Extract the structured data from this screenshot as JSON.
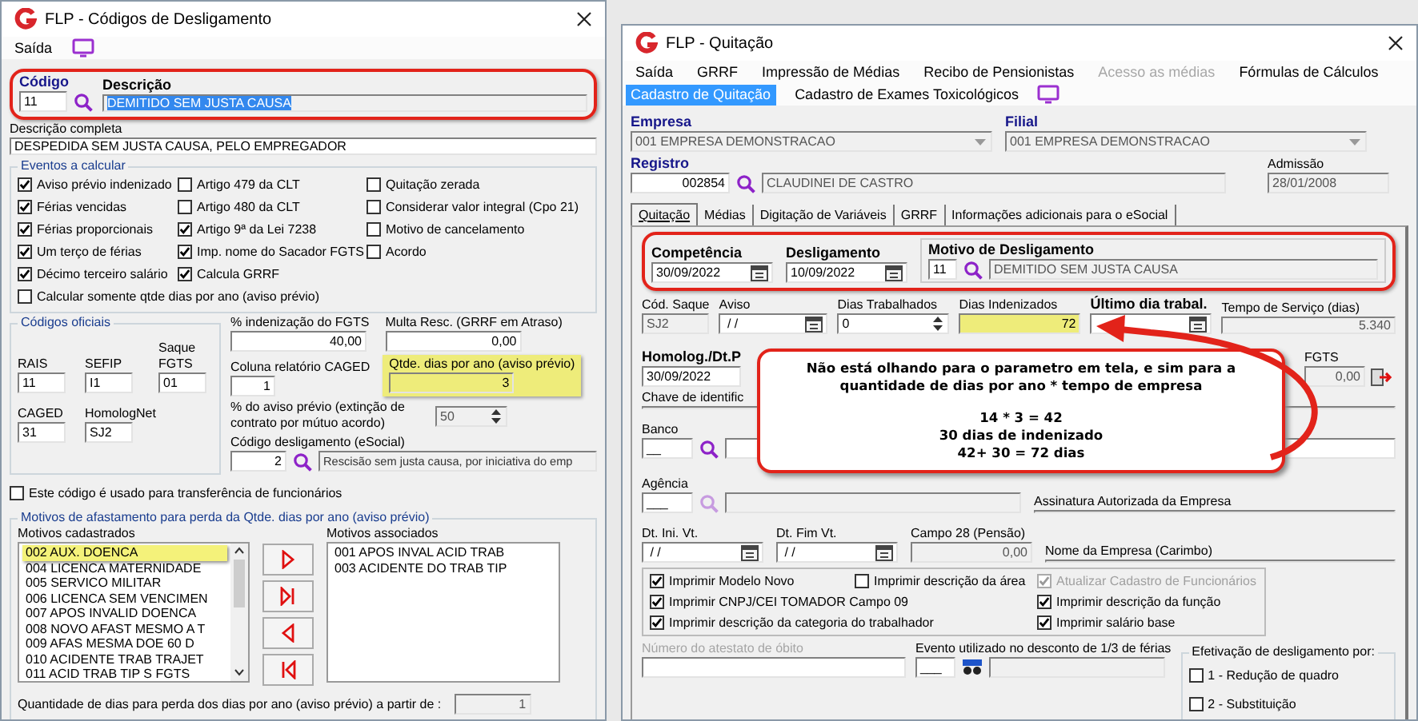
{
  "left_window": {
    "title": "FLP - Códigos de Desligamento",
    "menu": [
      {
        "label": "Saída"
      }
    ],
    "header": {
      "outlined": true,
      "codigo": {
        "label": "Código",
        "value": "11"
      },
      "descricao": {
        "label": "Descrição",
        "value": "DEMITIDO SEM JUSTA CAUSA",
        "selected": true
      }
    },
    "descricao_completa": {
      "label": "Descrição completa",
      "value": "DESPEDIDA SEM JUSTA CAUSA, PELO EMPREGADOR"
    },
    "eventos": {
      "title": "Eventos a calcular",
      "columns": [
        [
          {
            "label": "Aviso prévio indenizado",
            "checked": true
          },
          {
            "label": "Férias vencidas",
            "checked": true
          },
          {
            "label": "Férias proporcionais",
            "checked": true
          },
          {
            "label": "Um terço de férias",
            "checked": true
          },
          {
            "label": "Décimo terceiro salário",
            "checked": true
          }
        ],
        [
          {
            "label": "Artigo 479 da CLT",
            "checked": false
          },
          {
            "label": "Artigo 480 da CLT",
            "checked": false
          },
          {
            "label": "Artigo 9ª da Lei 7238",
            "checked": true
          },
          {
            "label": "Imp. nome do Sacador FGTS",
            "checked": true
          },
          {
            "label": "Calcula GRRF",
            "checked": true
          }
        ],
        [
          {
            "label": "Quitação zerada",
            "checked": false
          },
          {
            "label": "Considerar valor integral (Cpo 21)",
            "checked": false
          },
          {
            "label": "Motivo de cancelamento",
            "checked": false
          },
          {
            "label": "Acordo",
            "checked": false
          }
        ]
      ],
      "bottom": {
        "label": "Calcular somente qtde dias por ano (aviso prévio)",
        "checked": false
      }
    },
    "codigos_oficiais": {
      "title": "Códigos oficiais",
      "fields": [
        {
          "label": "RAIS",
          "value": "11"
        },
        {
          "label": "SEFIP",
          "value": "I1"
        },
        {
          "label": "Saque FGTS",
          "value": "01"
        },
        {
          "label": "CAGED",
          "value": "31"
        },
        {
          "label": "HomologNet",
          "value": "SJ2"
        }
      ]
    },
    "indenizacao_fgts": {
      "label": "% indenização do FGTS",
      "value": "40,00"
    },
    "multa_rescisoria": {
      "label": "Multa Resc. (GRRF em Atraso)",
      "value": "0,00"
    },
    "coluna_caged": {
      "label": "Coluna relatório CAGED",
      "value": "1"
    },
    "qtde_dias": {
      "label": "Qtde. dias por ano (aviso prévio)",
      "value": "3",
      "highlighted": true
    },
    "aviso_previo_percent": {
      "label": "% do aviso prévio (extinção de contrato por mútuo acordo)",
      "value": "50",
      "disabled": true
    },
    "codigo_esocial": {
      "label": "Código desligamento (eSocial)",
      "value": "2",
      "description": "Rescisão sem justa causa, por iniciativa do emp"
    },
    "transferencia": {
      "label": "Este código é usado para transferência de funcionários",
      "checked": false
    },
    "motivos": {
      "title": "Motivos de afastamento para perda da Qtde. dias por ano (aviso prévio)",
      "cadastrados": {
        "label": "Motivos cadastrados",
        "items": [
          {
            "label": "002 AUX. DOENCA",
            "selected": true
          },
          {
            "label": "004 LICENCA MATERNIDADE",
            "selected": false
          },
          {
            "label": "005 SERVICO MILITAR",
            "selected": false
          },
          {
            "label": "006 LICENCA SEM VENCIMEN",
            "selected": false
          },
          {
            "label": "007 APOS INVALID DOENCA",
            "selected": false
          },
          {
            "label": "008 NOVO AFAST MESMO A T",
            "selected": false
          },
          {
            "label": "009 AFAS MESMA DOE 60  D",
            "selected": false
          },
          {
            "label": "010 ACIDENTE TRAB TRAJET",
            "selected": false
          },
          {
            "label": "011 ACID TRAB TIP S FGTS",
            "selected": false
          }
        ]
      },
      "associados": {
        "label": "Motivos associados",
        "items": [
          {
            "label": "001 APOS INVAL ACID TRAB",
            "selected": false
          },
          {
            "label": "003 ACIDENTE DO TRAB TIP",
            "selected": false
          }
        ]
      },
      "quantidade": {
        "label": "Quantidade de dias para perda dos dias por ano (aviso prévio) a  partir de :",
        "value": "1"
      }
    }
  },
  "right_window": {
    "title": "FLP - Quitação",
    "menu": [
      {
        "label": "Saída",
        "disabled": false
      },
      {
        "label": "GRRF",
        "disabled": false
      },
      {
        "label": "Impressão de Médias",
        "disabled": false
      },
      {
        "label": "Recibo de Pensionistas",
        "disabled": false
      },
      {
        "label": "Acesso as médias",
        "disabled": true
      },
      {
        "label": "Fórmulas de Cálculos",
        "disabled": false
      }
    ],
    "menu_row2": [
      {
        "label": "Cadastro de Quitação",
        "selected": true
      },
      {
        "label": "Cadastro de Exames Toxicológicos",
        "selected": false
      }
    ],
    "empresa": {
      "label": "Empresa",
      "value": "001 EMPRESA DEMONSTRACAO"
    },
    "filial": {
      "label": "Filial",
      "value": "001 EMPRESA DEMONSTRACAO"
    },
    "registro": {
      "label": "Registro",
      "value": "002854",
      "name": "CLAUDINEI DE CASTRO"
    },
    "admissao": {
      "label": "Admissão",
      "value": "28/01/2008"
    },
    "tabs": [
      {
        "label": "Quitação",
        "selected": true
      },
      {
        "label": "Médias",
        "selected": false
      },
      {
        "label": "Digitação de Variáveis",
        "selected": false
      },
      {
        "label": "GRRF",
        "selected": false
      },
      {
        "label": "Informações adicionais para o eSocial",
        "selected": false
      }
    ],
    "periodo": {
      "outlined": true,
      "competencia": {
        "label": "Competência",
        "value": "30/09/2022"
      },
      "desligamento": {
        "label": "Desligamento",
        "value": "10/09/2022"
      },
      "motivo": {
        "label": "Motivo de Desligamento",
        "value": "11",
        "description": "DEMITIDO SEM JUSTA CAUSA"
      }
    },
    "cod_saque": {
      "label": "Cód. Saque",
      "value": "SJ2"
    },
    "aviso": {
      "label": "Aviso",
      "value": " / /"
    },
    "dias_trabalhados": {
      "label": "Dias Trabalhados",
      "value": "0"
    },
    "dias_indenizados": {
      "label": "Dias Indenizados",
      "value": "72",
      "highlighted": true
    },
    "ultimo_dia": {
      "label": "Último dia trabal."
    },
    "tempo_servico": {
      "label": "Tempo de Serviço (dias)",
      "value": "5.340"
    },
    "homologacao": {
      "label": "Homolog./Dt.P",
      "value": "30/09/2022"
    },
    "fgts": {
      "label": "FGTS",
      "value": "0,00"
    },
    "chave": {
      "label": "Chave de identific"
    },
    "banco": {
      "label": "Banco",
      "value": "__"
    },
    "agencia": {
      "label": "Agência",
      "value": "___"
    },
    "assinatura": {
      "label": "Assinatura Autorizada da Empresa"
    },
    "dt_ini_vt": {
      "label": "Dt. Ini. Vt.",
      "value": " / /"
    },
    "dt_fim_vt": {
      "label": "Dt. Fim Vt.",
      "value": " / /"
    },
    "campo28": {
      "label": "Campo 28 (Pensão)",
      "value": "0,00"
    },
    "nome_empresa": {
      "label": "Nome da Empresa (Carimbo)"
    },
    "opcoes": {
      "rows": [
        [
          {
            "label": "Imprimir Modelo Novo",
            "checked": true,
            "disabled": false
          },
          {
            "label": "Imprimir descrição da área",
            "checked": false,
            "disabled": false
          },
          {
            "label": "Atualizar Cadastro de Funcionários",
            "checked": true,
            "disabled": true
          }
        ],
        [
          {
            "label": "Imprimir CNPJ/CEI TOMADOR Campo 09",
            "checked": true,
            "disabled": false
          },
          {
            "label": "Imprimir descrição da função",
            "checked": true,
            "disabled": false
          }
        ],
        [
          {
            "label": "Imprimir descrição da categoria do trabalhador",
            "checked": true,
            "disabled": false
          },
          {
            "label": "Imprimir salário base",
            "checked": true,
            "disabled": false
          }
        ]
      ]
    },
    "atestado_obito": {
      "label": "Número do atestato de óbito",
      "disabled": true
    },
    "evento_ferias": {
      "label": "Evento utilizado no desconto de 1/3 de férias",
      "value": "___"
    },
    "efetivacao": {
      "title": "Efetivação de desligamento por:",
      "options": [
        {
          "label": "1 - Redução de quadro",
          "checked": false
        },
        {
          "label": "2 - Substituição",
          "checked": false
        }
      ]
    },
    "callout": {
      "text": "Não está olhando para o parametro em tela, e sim para a quantidade de dias por ano * tempo de empresa",
      "lines": [
        "14 * 3 = 42",
        "30 dias de indenizado",
        "42+ 30 = 72 dias"
      ]
    }
  }
}
